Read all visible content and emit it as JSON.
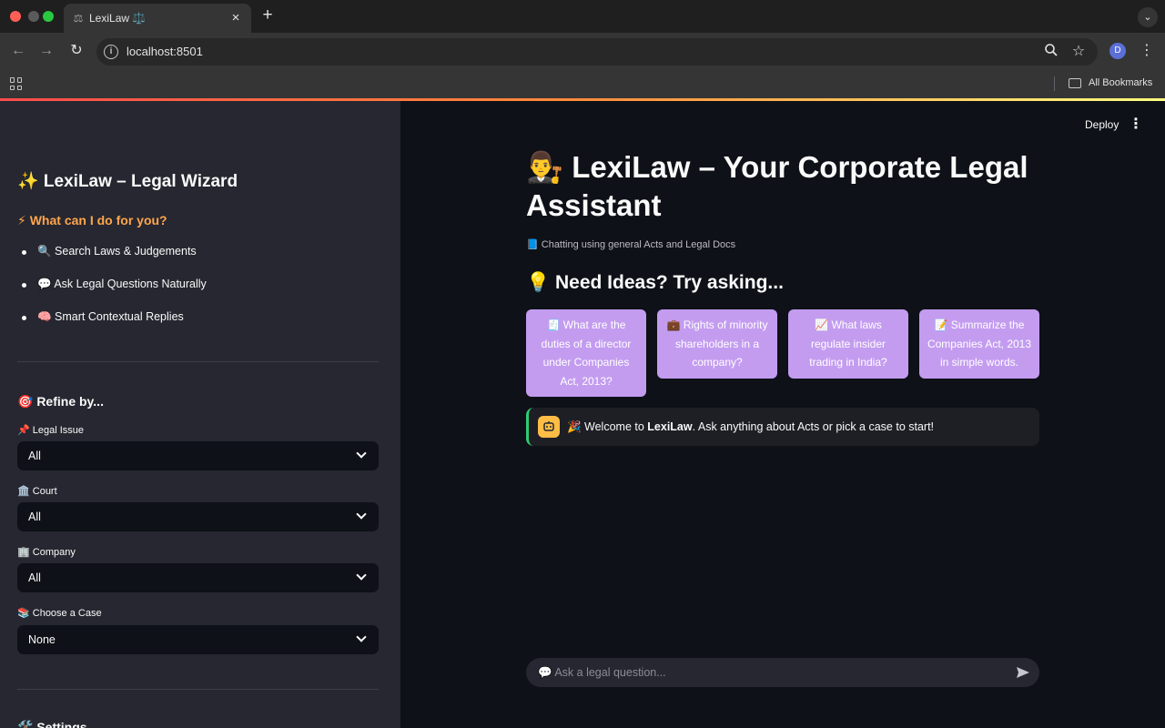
{
  "browser": {
    "tab_title": "LexiLaw ⚖️",
    "tab_favicon": "⚖",
    "url": "localhost:8501",
    "profile_initial": "D",
    "bookmarks_label": "All Bookmarks"
  },
  "sidebar": {
    "title": "✨ LexiLaw – Legal Wizard",
    "subtitle": "⚡ What can I do for you?",
    "features": [
      "🔍 Search Laws & Judgements",
      "💬 Ask Legal Questions Naturally",
      "🧠 Smart Contextual Replies"
    ],
    "refine_title": "🎯 Refine by...",
    "filters": [
      {
        "label": "📌 Legal Issue",
        "value": "All"
      },
      {
        "label": "🏛️ Court",
        "value": "All"
      },
      {
        "label": "🏢 Company",
        "value": "All"
      },
      {
        "label": "📚 Choose a Case",
        "value": "None"
      }
    ],
    "settings_title": "🛠️ Settings"
  },
  "main": {
    "deploy_label": "Deploy",
    "title": "👨‍⚖️ LexiLaw – Your Corporate Legal Assistant",
    "caption": "📘 Chatting using general Acts and Legal Docs",
    "ideas_title": "💡 Need Ideas? Try asking...",
    "ideas": [
      "🧾 What are the duties of a director under Companies Act, 2013?",
      "💼 Rights of minority shareholders in a company?",
      "📈 What laws regulate insider trading in India?",
      "📝 Summarize the Companies Act, 2013 in simple words."
    ],
    "welcome": {
      "prefix": "🎉 Welcome to ",
      "brand": "LexiLaw",
      "suffix": ". Ask anything about Acts or pick a case to start!"
    },
    "chat_placeholder": "💬 Ask a legal question..."
  },
  "colors": {
    "accent_orange": "#ffa64d",
    "idea_card": "#c39cf0",
    "bot_avatar": "#ffbd45",
    "welcome_border": "#2ecc71"
  }
}
